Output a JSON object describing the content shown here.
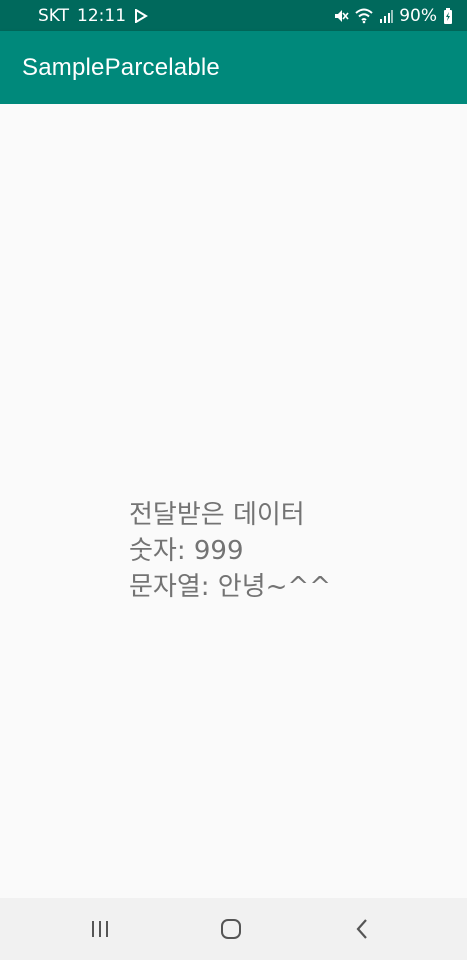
{
  "status_bar": {
    "carrier": "SKT",
    "time": "12:11",
    "battery": "90%",
    "icons": [
      "play-store-icon",
      "mute-icon",
      "wifi-icon",
      "signal-icon",
      "battery-charging-icon"
    ]
  },
  "app_bar": {
    "title": "SampleParcelable"
  },
  "content": {
    "lines": [
      "전달받은 데이터",
      "숫자: 999",
      "문자열: 안녕~^^"
    ]
  },
  "nav_bar": {
    "buttons": [
      "recent-apps-icon",
      "home-icon",
      "back-icon"
    ]
  },
  "colors": {
    "status_bar": "#00695c",
    "app_bar": "#00897b",
    "background": "#fafafa",
    "text": "#737373",
    "nav_bar": "#f1f1f1"
  }
}
